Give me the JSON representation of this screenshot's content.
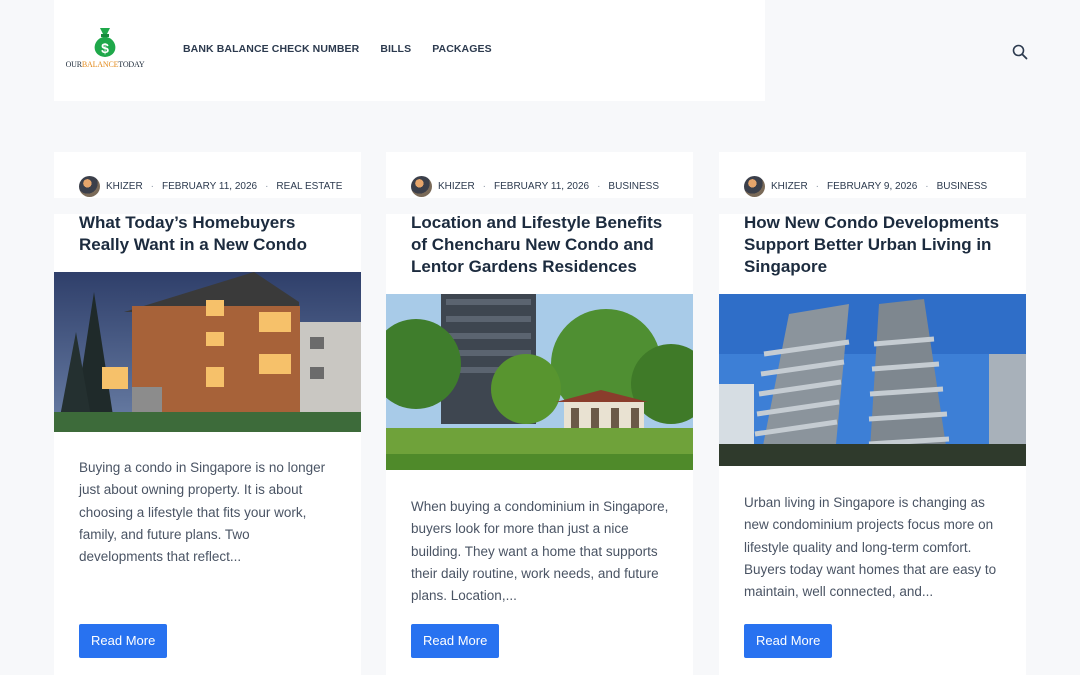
{
  "header": {
    "logo_text_a": "OUR",
    "logo_text_b": "BALANCE",
    "logo_text_c": "TODAY",
    "nav": [
      "BANK BALANCE CHECK NUMBER",
      "BILLS",
      "PACKAGES"
    ]
  },
  "posts": [
    {
      "author": "KHIZER",
      "date": "FEBRUARY 11, 2026",
      "category": "REAL ESTATE",
      "title": "What Today’s Homebuyers Really Want in a New Condo",
      "excerpt": "Buying a condo in Singapore is no longer just about owning property. It is about choosing a lifestyle that fits your work, family, and future plans. Two developments that reflect...",
      "button": "Read More"
    },
    {
      "author": "KHIZER",
      "date": "FEBRUARY 11, 2026",
      "category": "BUSINESS",
      "title": "Location and Lifestyle Benefits of Chencharu New Condo and Lentor Gardens Residences",
      "excerpt": "When buying a condominium in Singapore, buyers look for more than just a nice building. They want a home that supports their daily routine, work needs, and future plans. Location,...",
      "button": "Read More"
    },
    {
      "author": "KHIZER",
      "date": "FEBRUARY 9, 2026",
      "category": "BUSINESS",
      "title": "How New Condo Developments Support Better Urban Living in Singapore",
      "excerpt": "Urban living in Singapore is changing as new condominium projects focus more on lifestyle quality and long-term comfort. Buyers today want homes that are easy to maintain, well connected, and...",
      "button": "Read More"
    }
  ],
  "colors": {
    "accent": "#2872f0",
    "logo_green": "#1fa84a",
    "logo_orange": "#e38b1e"
  },
  "icons": {
    "logo": "money-bag-icon",
    "search": "search-icon"
  }
}
